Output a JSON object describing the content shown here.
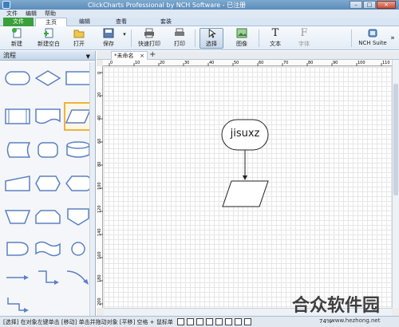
{
  "window": {
    "title": "ClickCharts Professional by NCH Software - 已注册",
    "minimize": "–",
    "maximize": "□",
    "close": "×"
  },
  "menu": {
    "items": [
      "文件",
      "编辑",
      "帮助"
    ]
  },
  "ribbon": {
    "tabs": [
      "文件",
      "主页",
      "查看",
      "编辑",
      "套装"
    ]
  },
  "toolbar": {
    "new": "新建",
    "new_blank": "新建空白",
    "open": "打开",
    "save": "保存",
    "quick_print": "快速打印",
    "print": "打印",
    "select": "选择",
    "image": "图像",
    "text": "文本",
    "font": "字体",
    "nch_suite": "NCH Suite",
    "more": "»"
  },
  "panel": {
    "title": "流程",
    "dropdown": "▼"
  },
  "document": {
    "tab_label": "*未命名",
    "tab_close": "×",
    "new_tab": "+",
    "ruler_top": [
      "0",
      "10",
      "20",
      "30",
      "40",
      "50",
      "60",
      "70",
      "80",
      "90",
      "100",
      "110"
    ],
    "ruler_left": [
      "0",
      "20",
      "40",
      "60",
      "80",
      "100",
      "120",
      "140",
      "160",
      "180",
      "200"
    ]
  },
  "diagram": {
    "node_text": "jisuxz"
  },
  "status": {
    "text": "[选择] 在对象左键单击 [移动] 单击并拖动对象 [平移] 空格 + 鼠标单",
    "zoom": "74%"
  },
  "watermark": {
    "text": "合众软件园",
    "url": "www.hezhong.net"
  },
  "colors": {
    "accent": "#3b9f3b",
    "shape_stroke": "#5b80c2",
    "selected": "#f0b23c"
  }
}
